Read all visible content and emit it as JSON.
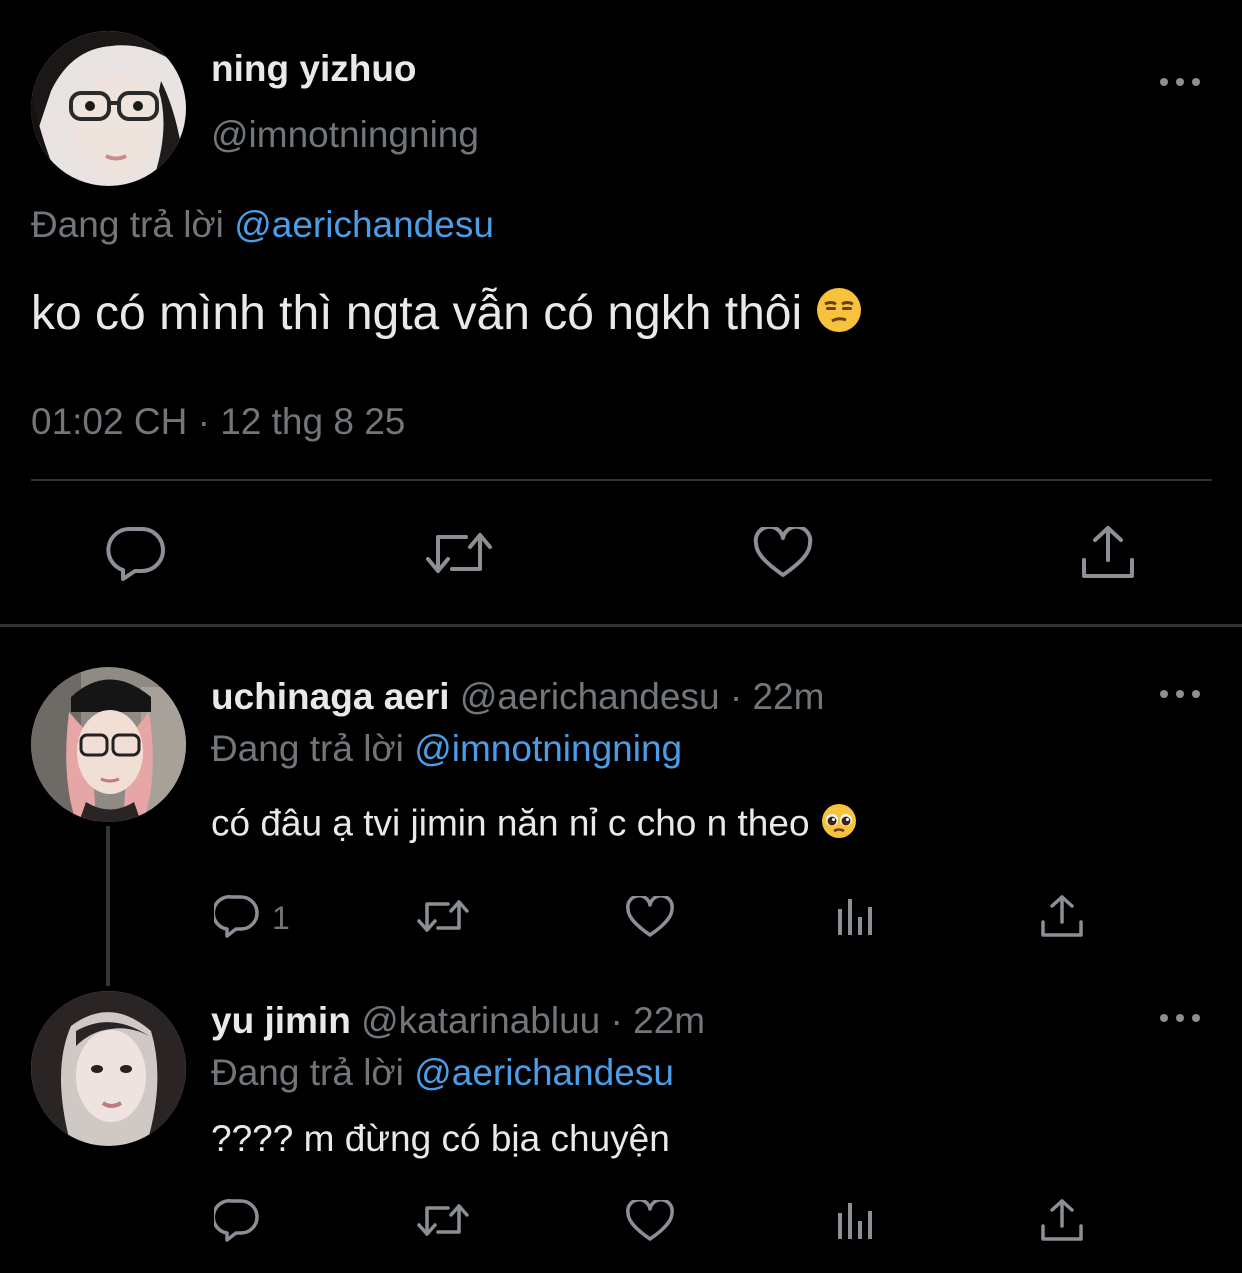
{
  "main_tweet": {
    "display_name": "ning yizhuo",
    "handle": "@imnotningning",
    "replying_prefix": "Đang trả lời",
    "replying_to": "@aerichandesu",
    "text": "ko có mình thì ngta vẫn có ngkh thôi",
    "emoji": "unamused-face",
    "timestamp": "01:02 CH · 12 thg 8 25",
    "actions": [
      "reply-icon",
      "retweet-icon",
      "like-icon",
      "share-icon"
    ]
  },
  "replies": [
    {
      "display_name": "uchinaga aeri",
      "handle": "@aerichandesu",
      "separator": "·",
      "time": "22m",
      "replying_prefix": "Đang trả lời",
      "replying_to": "@imnotningning",
      "text": "có đâu ạ tvi jimin năn nỉ c cho n theo",
      "emoji": "pleading-face",
      "reply_count": "1"
    },
    {
      "display_name": "yu jimin",
      "handle": "@katarinabluu",
      "separator": "·",
      "time": "22m",
      "replying_prefix": "Đang trả lời",
      "replying_to": "@aerichandesu",
      "text": "???? m đừng có bịa chuyện"
    }
  ],
  "colors": {
    "background": "#000000",
    "text": "#e7e9ea",
    "muted": "#71767b",
    "link": "#4a9de6",
    "divider": "#2f3336"
  }
}
